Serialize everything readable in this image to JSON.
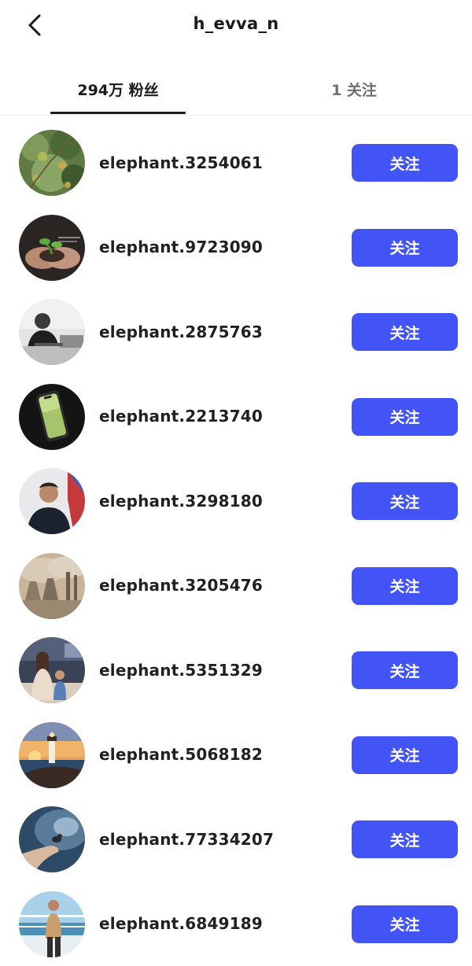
{
  "header": {
    "title": "h_evva_n",
    "back_icon": "chevron-left-icon"
  },
  "tabs": [
    {
      "label": "294万 粉丝",
      "active": true
    },
    {
      "label": "1 关注",
      "active": false
    }
  ],
  "colors": {
    "accent": "#4254f5",
    "text_primary": "#1b1b1f",
    "text_secondary": "#6d6e78"
  },
  "followers": [
    {
      "username": "elephant.3254061",
      "button_label": "关注",
      "avatar": "orange-tree-photo"
    },
    {
      "username": "elephant.9723090",
      "button_label": "关注",
      "avatar": "hands-with-seedling-photo"
    },
    {
      "username": "elephant.2875763",
      "button_label": "关注",
      "avatar": "man-at-desk-bw-photo"
    },
    {
      "username": "elephant.2213740",
      "button_label": "关注",
      "avatar": "phone-screen-photo"
    },
    {
      "username": "elephant.3298180",
      "button_label": "关注",
      "avatar": "man-portrait-photo"
    },
    {
      "username": "elephant.3205476",
      "button_label": "关注",
      "avatar": "factory-smoke-photo"
    },
    {
      "username": "elephant.5351329",
      "button_label": "关注",
      "avatar": "family-on-sofa-photo"
    },
    {
      "username": "elephant.5068182",
      "button_label": "关注",
      "avatar": "lighthouse-sunset-photo"
    },
    {
      "username": "elephant.77334207",
      "button_label": "关注",
      "avatar": "hand-with-bird-photo"
    },
    {
      "username": "elephant.6849189",
      "button_label": "关注",
      "avatar": "man-on-boat-photo"
    }
  ]
}
